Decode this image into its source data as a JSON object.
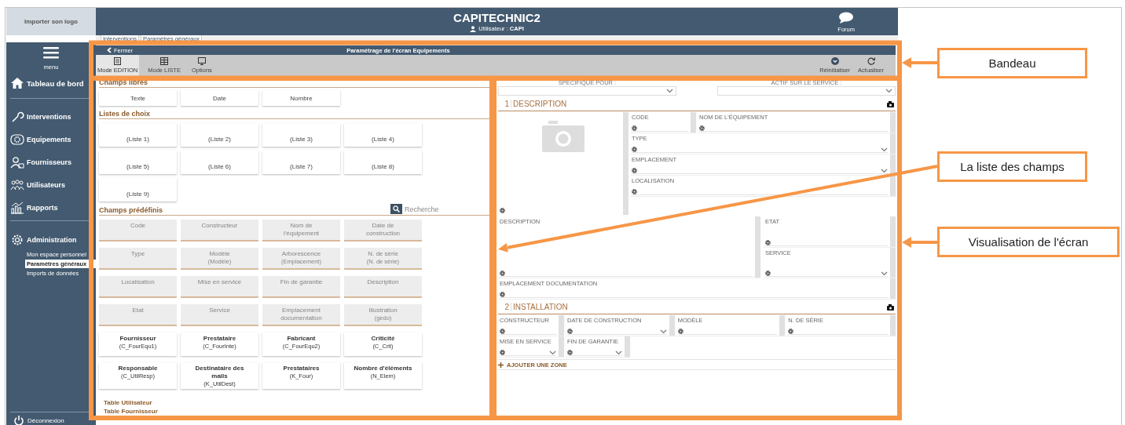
{
  "logo_placeholder": "Importer son logo",
  "header": {
    "title": "CAPITECHNIC2",
    "user": "Utilisateur : **CAPI**",
    "forum": "Forum"
  },
  "breadcrumb_tabs": [
    {
      "label": "Interventions"
    },
    {
      "label": "Paramètres généraux"
    }
  ],
  "sidebar": {
    "menu_label": "menu",
    "items": [
      {
        "label": "Tableau de bord"
      },
      {
        "label": "Interventions"
      },
      {
        "label": "Equipements"
      },
      {
        "label": "Fournisseurs"
      },
      {
        "label": "Utilisateurs"
      },
      {
        "label": "Rapports"
      }
    ],
    "admin": {
      "label": "Administration",
      "children": [
        {
          "label": "Mon espace personnel",
          "selected": false
        },
        {
          "label": "Paramètres généraux",
          "selected": true
        },
        {
          "label": "Imports de données",
          "selected": false
        }
      ]
    },
    "logout": "Déconnexion"
  },
  "editor": {
    "close": "Fermer",
    "title": "Paramétrage de l'écran Equipements",
    "modes": [
      {
        "label": "Mode EDITION",
        "selected": true
      },
      {
        "label": "Mode LISTE",
        "selected": false
      },
      {
        "label": "Options",
        "selected": false
      }
    ],
    "actions": [
      {
        "label": "Réinitialiser"
      },
      {
        "label": "Actualiser"
      }
    ]
  },
  "fields_panel": {
    "free_title": "Champs libres",
    "free_fields": [
      "Texte",
      "Date",
      "Nombre"
    ],
    "lists_title": "Listes de choix",
    "lists": [
      "(Liste 1)",
      "(Liste 2)",
      "(Liste 3)",
      "(Liste 4)",
      "(Liste 5)",
      "(Liste 6)",
      "(Liste 7)",
      "(Liste 8)",
      "(Liste 9)"
    ],
    "predefined_title": "Champs prédéfinis",
    "search": {
      "placeholder": "Recherche"
    },
    "predefined": [
      {
        "name": "Code",
        "disabled": true
      },
      {
        "name": "Constructeur",
        "disabled": true
      },
      {
        "name": "Nom de l'équipement",
        "disabled": true
      },
      {
        "name": "Date de construction",
        "disabled": true
      },
      {
        "name": "Type",
        "disabled": true
      },
      {
        "name": "Modèle",
        "code": "(Modèle)",
        "disabled": true
      },
      {
        "name": "Arborescence",
        "code": "(Emplacement)",
        "disabled": true
      },
      {
        "name": "N. de série",
        "code": "(N. de série)",
        "disabled": true
      },
      {
        "name": "Localisation",
        "disabled": true
      },
      {
        "name": "Mise en service",
        "disabled": true
      },
      {
        "name": "Fin de garantie",
        "disabled": true
      },
      {
        "name": "Description",
        "disabled": true
      },
      {
        "name": "Etat",
        "disabled": true
      },
      {
        "name": "Service",
        "disabled": true
      },
      {
        "name": "Emplacement documentation",
        "disabled": true
      },
      {
        "name": "Illustration",
        "code": "(gedo)",
        "disabled": true
      },
      {
        "name": "Fournisseur",
        "code": "(C_FourEqu1)",
        "disabled": false
      },
      {
        "name": "Prestataire",
        "code": "(C_FourInte)",
        "disabled": false
      },
      {
        "name": "Fabricant",
        "code": "(C_FourEqu2)",
        "disabled": false
      },
      {
        "name": "Criticité",
        "code": "(C_Crit)",
        "disabled": false
      },
      {
        "name": "Responsable",
        "code": "(C_UtilResp)",
        "disabled": false
      },
      {
        "name": "Destinataire des mails",
        "code": "(K_UtilDest)",
        "disabled": false
      },
      {
        "name": "Prestataires",
        "code": "(K_Four)",
        "disabled": false
      },
      {
        "name": "Nombre d'éléments",
        "code": "(N_Elem)",
        "disabled": false
      }
    ],
    "tables": [
      "Table Utilisateur",
      "Table Fournisseur"
    ]
  },
  "preview": {
    "selects": [
      {
        "label": "SPECIFIQUE POUR :"
      },
      {
        "label": "ACTIF SUR LE SERVICE :"
      }
    ],
    "zones": [
      {
        "number": "1",
        "title": "DESCRIPTION",
        "blocks": [
          {
            "kind": "photo",
            "rows": [
              [
                {
                  "label": "CODE",
                  "kind": "text"
                },
                {
                  "label": "NOM DE L'ÉQUIPEMENT",
                  "kind": "text"
                }
              ],
              [
                {
                  "label": "TYPE",
                  "kind": "select"
                }
              ],
              [
                {
                  "label": "EMPLACEMENT",
                  "kind": "select"
                }
              ],
              [
                {
                  "label": "LOCALISATION",
                  "kind": "text"
                }
              ]
            ]
          },
          {
            "kind": "split",
            "main": {
              "label": "DESCRIPTION",
              "kind": "textarea"
            },
            "side": [
              {
                "label": "ETAT",
                "kind": "text"
              },
              {
                "label": "SERVICE",
                "kind": "select"
              }
            ]
          },
          {
            "kind": "row",
            "fields": [
              {
                "label": "EMPLACEMENT DOCUMENTATION",
                "kind": "text"
              }
            ]
          }
        ]
      },
      {
        "number": "2",
        "title": "INSTALLATION",
        "blocks": [
          {
            "kind": "row",
            "fields": [
              {
                "label": "CONSTRUCTEUR",
                "kind": "text"
              },
              {
                "label": "DATE DE CONSTRUCTION",
                "kind": "select"
              },
              {
                "label": "MODÈLE",
                "kind": "text"
              },
              {
                "label": "N. DE SÉRIE",
                "kind": "text"
              }
            ]
          },
          {
            "kind": "compact-row",
            "fields": [
              {
                "label": "MISE EN SERVICE",
                "kind": "select"
              },
              {
                "label": "FIN DE GARANTIE",
                "kind": "select"
              }
            ]
          }
        ]
      }
    ],
    "add_zone": "AJOUTER UNE ZONE"
  },
  "annotations": [
    {
      "label": "Bandeau"
    },
    {
      "label": "La liste des champs"
    },
    {
      "label": "Visualisation de l'écran"
    }
  ]
}
